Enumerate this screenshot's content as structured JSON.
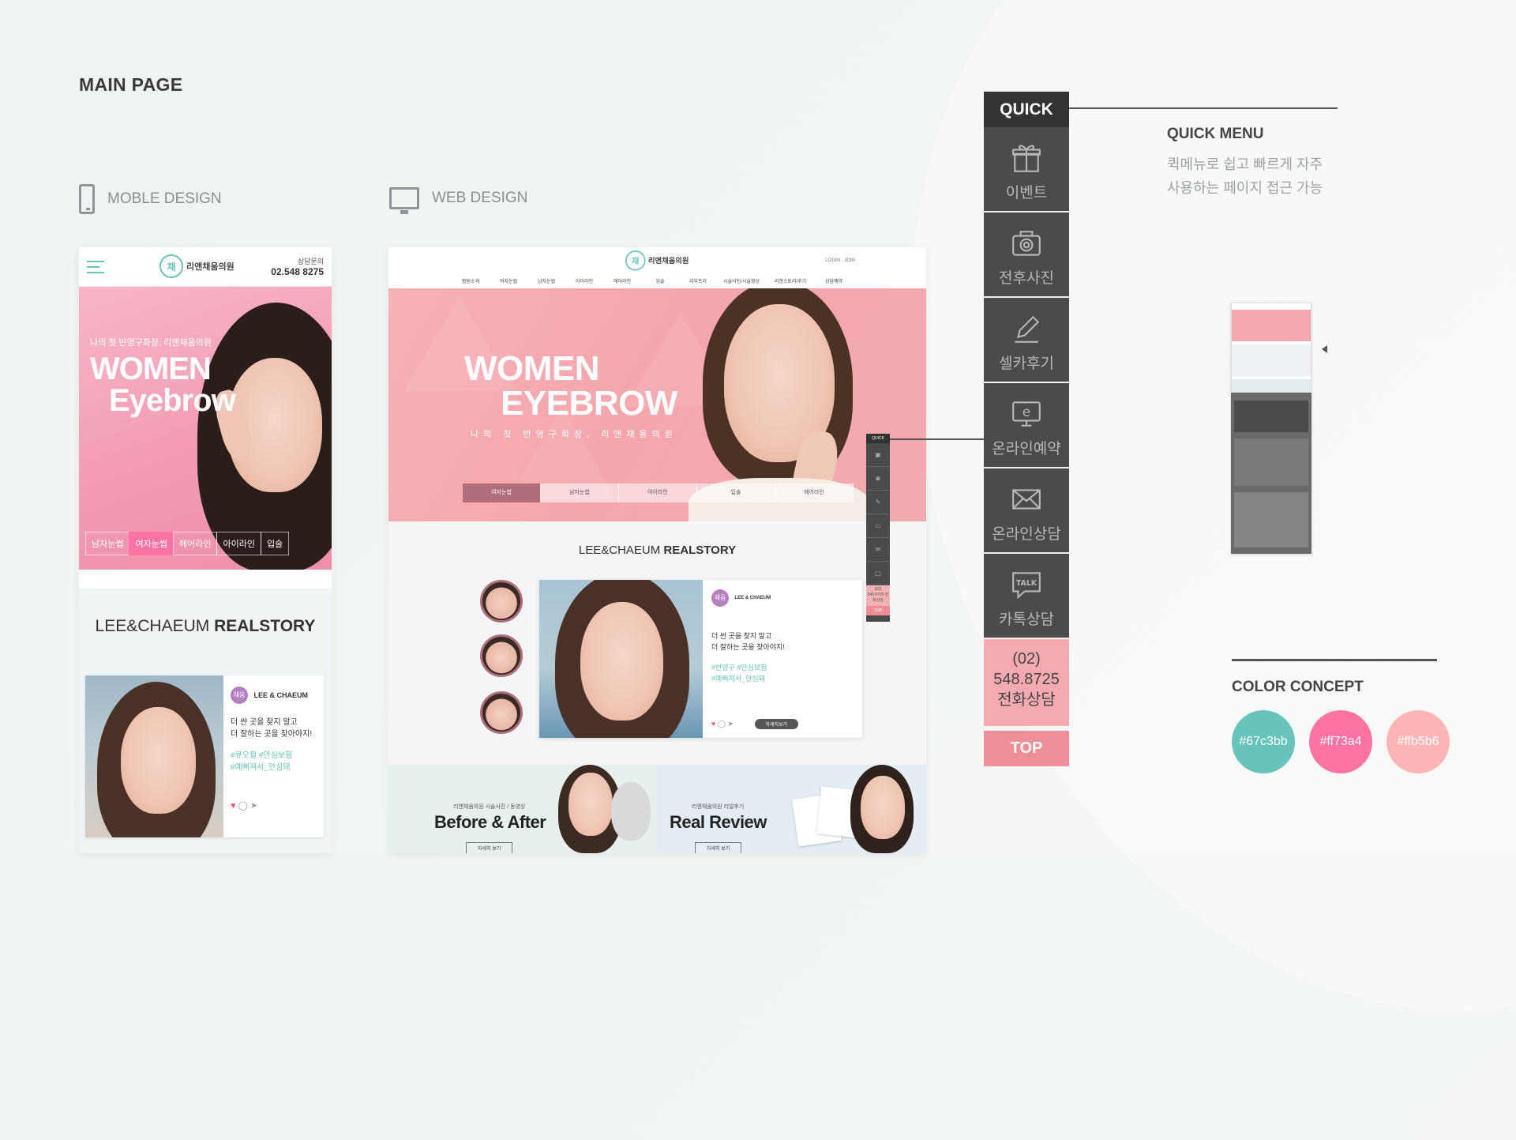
{
  "page": {
    "title": "MAIN PAGE",
    "mobile_label": "MOBLE DESIGN",
    "web_label": "WEB DESIGN"
  },
  "mobile": {
    "logo_text": "리앤채움의원",
    "contact_label": "상담문의",
    "contact_phone": "02.548 8275",
    "hero_sub": "나의 첫 반영구화장, 리앤채움의원",
    "hero_title_1": "WOMEN",
    "hero_title_2": "Eyebrow",
    "tabs": [
      "남자눈썹",
      "여자눈썹",
      "헤어라인",
      "아이라인",
      "입술"
    ],
    "active_tab": 1,
    "story_title_light": "LEE&CHAEUM",
    "story_title_bold": "REALSTORY",
    "card": {
      "badge": "채움",
      "brand": "LEE & CHAEUM",
      "body_1": "더 싼 곳을 찾지 말고",
      "body_2": "더 잘하는 곳을 찾아야지!",
      "tags_1": "#큐오필 #안심보험",
      "tags_2": "#예뻐져서_안심돼"
    }
  },
  "web": {
    "logo_text": "리앤채움의원",
    "login": "LOGIN · JOIN",
    "nav": [
      "병원소개",
      "여자눈썹",
      "남자눈썹",
      "아이라인",
      "헤어라인",
      "입술",
      "리부트러",
      "시술사진/시술영상",
      "리앤스토리/후기",
      "상담예약"
    ],
    "hero_title_1": "WOMEN",
    "hero_title_2": "EYEBROW",
    "hero_sub": "나의 첫 반영구화장, 리앤채움의원",
    "tabs": [
      "여자눈썹",
      "남자눈썹",
      "아이라인",
      "입술",
      "헤어라인"
    ],
    "active_tab": 0,
    "quick_mini": {
      "head": "QUICK",
      "call": "(02) 548.8725 전화상담",
      "top": "TOP"
    },
    "story_title_light": "LEE&CHAEUM",
    "story_title_bold": "REALSTORY",
    "card": {
      "badge": "채움",
      "brand": "LEE & CHAEUM",
      "body_1": "더 싼 곳을 찾지 말고",
      "body_2": "더 잘하는 곳을 찾아야지!",
      "tags_1": "#반영구 #안심보험",
      "tags_2": "#예뻐져서_안심돼",
      "more": "자세히보기"
    },
    "before_after": {
      "small": "리앤채움의원 시술사진 / 동영상",
      "big": "Before & After",
      "btn": "자세히 보기"
    },
    "real_review": {
      "small": "리앤채움의원 리얼후기",
      "big": "Real Review",
      "btn": "자세히 보기"
    }
  },
  "quick_panel": {
    "head": "QUICK",
    "items": [
      {
        "label": "이벤트",
        "icon": "gift-icon"
      },
      {
        "label": "전후사진",
        "icon": "camera-icon"
      },
      {
        "label": "셀카후기",
        "icon": "pencil-icon"
      },
      {
        "label": "온라인예약",
        "icon": "monitor-e-icon"
      },
      {
        "label": "온라인상담",
        "icon": "mail-icon"
      },
      {
        "label": "카톡상담",
        "icon": "talk-icon"
      }
    ],
    "call_1": "(02)",
    "call_2": "548.8725",
    "call_3": "전화상담",
    "top": "TOP"
  },
  "quick_menu": {
    "title": "QUICK MENU",
    "desc_1": "퀵메뉴로 쉽고 빠르게 자주",
    "desc_2": "사용하는 페이지 접근 가능"
  },
  "color_concept": {
    "title": "COLOR CONCEPT",
    "colors": [
      "#67c3bb",
      "#ff73a4",
      "#ffb5b6"
    ]
  }
}
